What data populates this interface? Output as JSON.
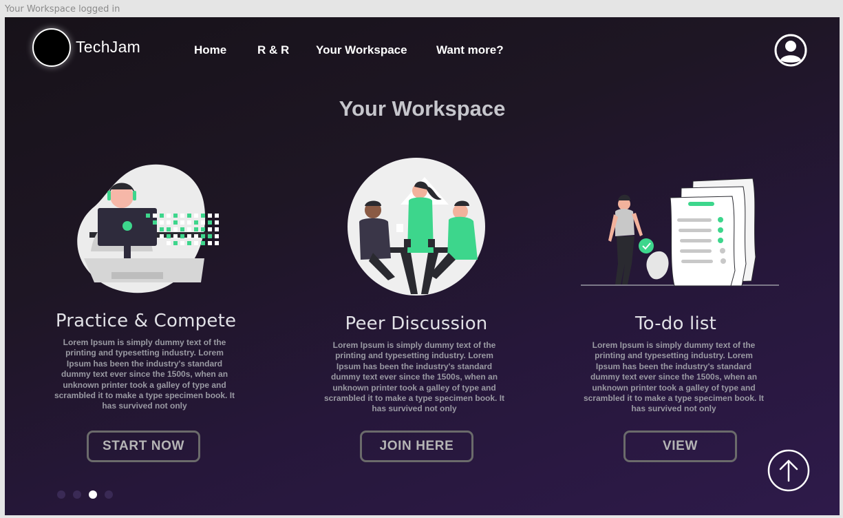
{
  "frame": {
    "label": "Your Workspace logged in"
  },
  "header": {
    "brand": "TechJam",
    "nav": [
      "Home",
      "R & R",
      "Your Workspace",
      "Want more?"
    ]
  },
  "main": {
    "title": "Your Workspace",
    "cards": [
      {
        "title": "Practice & Compete",
        "body": "Lorem Ipsum is simply dummy text of the printing and typesetting industry. Lorem Ipsum has been the industry's standard dummy text ever since the 1500s, when an unknown printer took a galley of type and scrambled it to make a type specimen book. It has survived not only",
        "button": "START NOW"
      },
      {
        "title": "Peer Discussion",
        "body": "Lorem Ipsum is simply dummy text of the printing and typesetting industry. Lorem Ipsum has been the industry's standard dummy text ever since the 1500s, when an unknown printer took a galley of type and scrambled it to make a type specimen book. It has survived not only",
        "button": "JOIN HERE"
      },
      {
        "title": "To-do list",
        "body": "Lorem Ipsum is simply dummy text of the printing and typesetting industry. Lorem Ipsum has been the industry's standard dummy text ever since the 1500s, when an unknown printer took a galley of type and scrambled it to make a type specimen book. It has survived not only",
        "button": "VIEW"
      }
    ]
  },
  "carousel": {
    "count": 4,
    "active_index": 2
  },
  "icons": {
    "profile": "user-circle-icon",
    "scroll_top": "arrow-up-circle-icon",
    "logo": "logo-circle-icon"
  },
  "colors": {
    "accent_green": "#3dd68c",
    "background_dark": "#1a1420",
    "background_purple": "#2e1a4a",
    "button_border": "#6b6b6b"
  }
}
